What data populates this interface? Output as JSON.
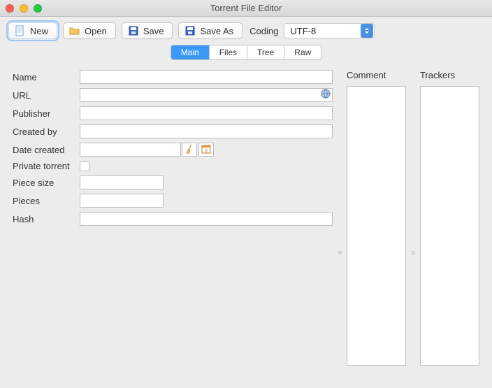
{
  "window": {
    "title": "Torrent File Editor"
  },
  "toolbar": {
    "new_label": "New",
    "open_label": "Open",
    "save_label": "Save",
    "saveas_label": "Save As",
    "coding_label": "Coding",
    "coding_value": "UTF-8"
  },
  "tabs": {
    "main": "Main",
    "files": "Files",
    "tree": "Tree",
    "raw": "Raw"
  },
  "form": {
    "name_label": "Name",
    "name_value": "",
    "url_label": "URL",
    "url_value": "",
    "publisher_label": "Publisher",
    "publisher_value": "",
    "createdby_label": "Created by",
    "createdby_value": "",
    "datecreated_label": "Date created",
    "datecreated_value": "",
    "private_label": "Private torrent",
    "private_checked": false,
    "piecesize_label": "Piece size",
    "piecesize_value": "",
    "pieces_label": "Pieces",
    "pieces_value": "",
    "hash_label": "Hash",
    "hash_value": ""
  },
  "side": {
    "comment_label": "Comment",
    "trackers_label": "Trackers"
  }
}
